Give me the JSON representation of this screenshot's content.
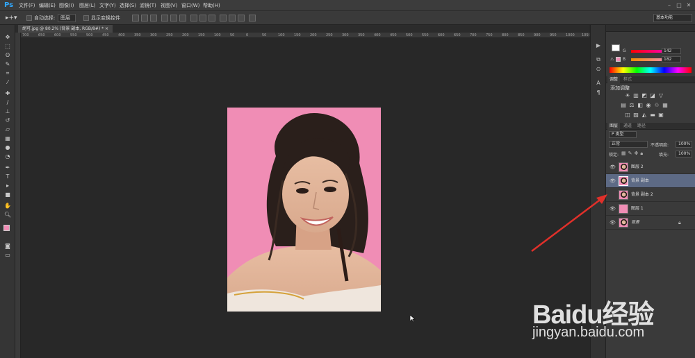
{
  "app": {
    "logo": "Ps",
    "accent": "#31a8ff"
  },
  "menu": [
    "文件(F)",
    "编辑(E)",
    "图像(I)",
    "图层(L)",
    "文字(Y)",
    "选择(S)",
    "滤镜(T)",
    "视图(V)",
    "窗口(W)",
    "帮助(H)"
  ],
  "options": {
    "auto_select_label": "自动选择:",
    "auto_select_value": "图层",
    "show_transform_label": "显示变换控件",
    "workspace": "基本功能"
  },
  "document": {
    "tab_title": "胡可.jpg @ 80.2% (背景 副本, RGB/8#) *",
    "ruler_labels": [
      "700",
      "650",
      "600",
      "550",
      "500",
      "450",
      "400",
      "350",
      "300",
      "250",
      "200",
      "150",
      "100",
      "50",
      "0",
      "50",
      "100",
      "150",
      "200",
      "250",
      "300",
      "350",
      "400",
      "450",
      "500",
      "550",
      "600",
      "650",
      "700",
      "750",
      "800",
      "850",
      "900",
      "950",
      "1000",
      "1050"
    ],
    "background_color": "#f08db5"
  },
  "color_panel": {
    "g_label": "G",
    "g_value": "142",
    "b_label": "B",
    "b_value": "182",
    "foreground": "#f08db5",
    "background": "#ffffff"
  },
  "adjustments_panel": {
    "tabs": [
      "调整",
      "样式"
    ],
    "title": "添加调整"
  },
  "layers_panel": {
    "tabs": [
      "图层",
      "通道",
      "路径"
    ],
    "filter_label": "P 类型",
    "blend_mode": "正常",
    "opacity_label": "不透明度:",
    "opacity_value": "100%",
    "lock_label": "锁定:",
    "fill_label": "填充:",
    "fill_value": "100%",
    "layers": [
      {
        "name": "图层 2",
        "visible": true,
        "thumb": "portrait"
      },
      {
        "name": "背景 副本",
        "visible": true,
        "thumb": "portrait",
        "selected": true
      },
      {
        "name": "背景 副本 2",
        "visible": false,
        "thumb": "portrait"
      },
      {
        "name": "图层 1",
        "visible": true,
        "thumb": "pink"
      },
      {
        "name": "背景",
        "visible": true,
        "thumb": "portrait",
        "locked": true
      }
    ]
  },
  "watermark": {
    "brand": "Baidu经验",
    "url": "jingyan.baidu.com"
  },
  "annotation": {
    "color": "#e0302a"
  }
}
